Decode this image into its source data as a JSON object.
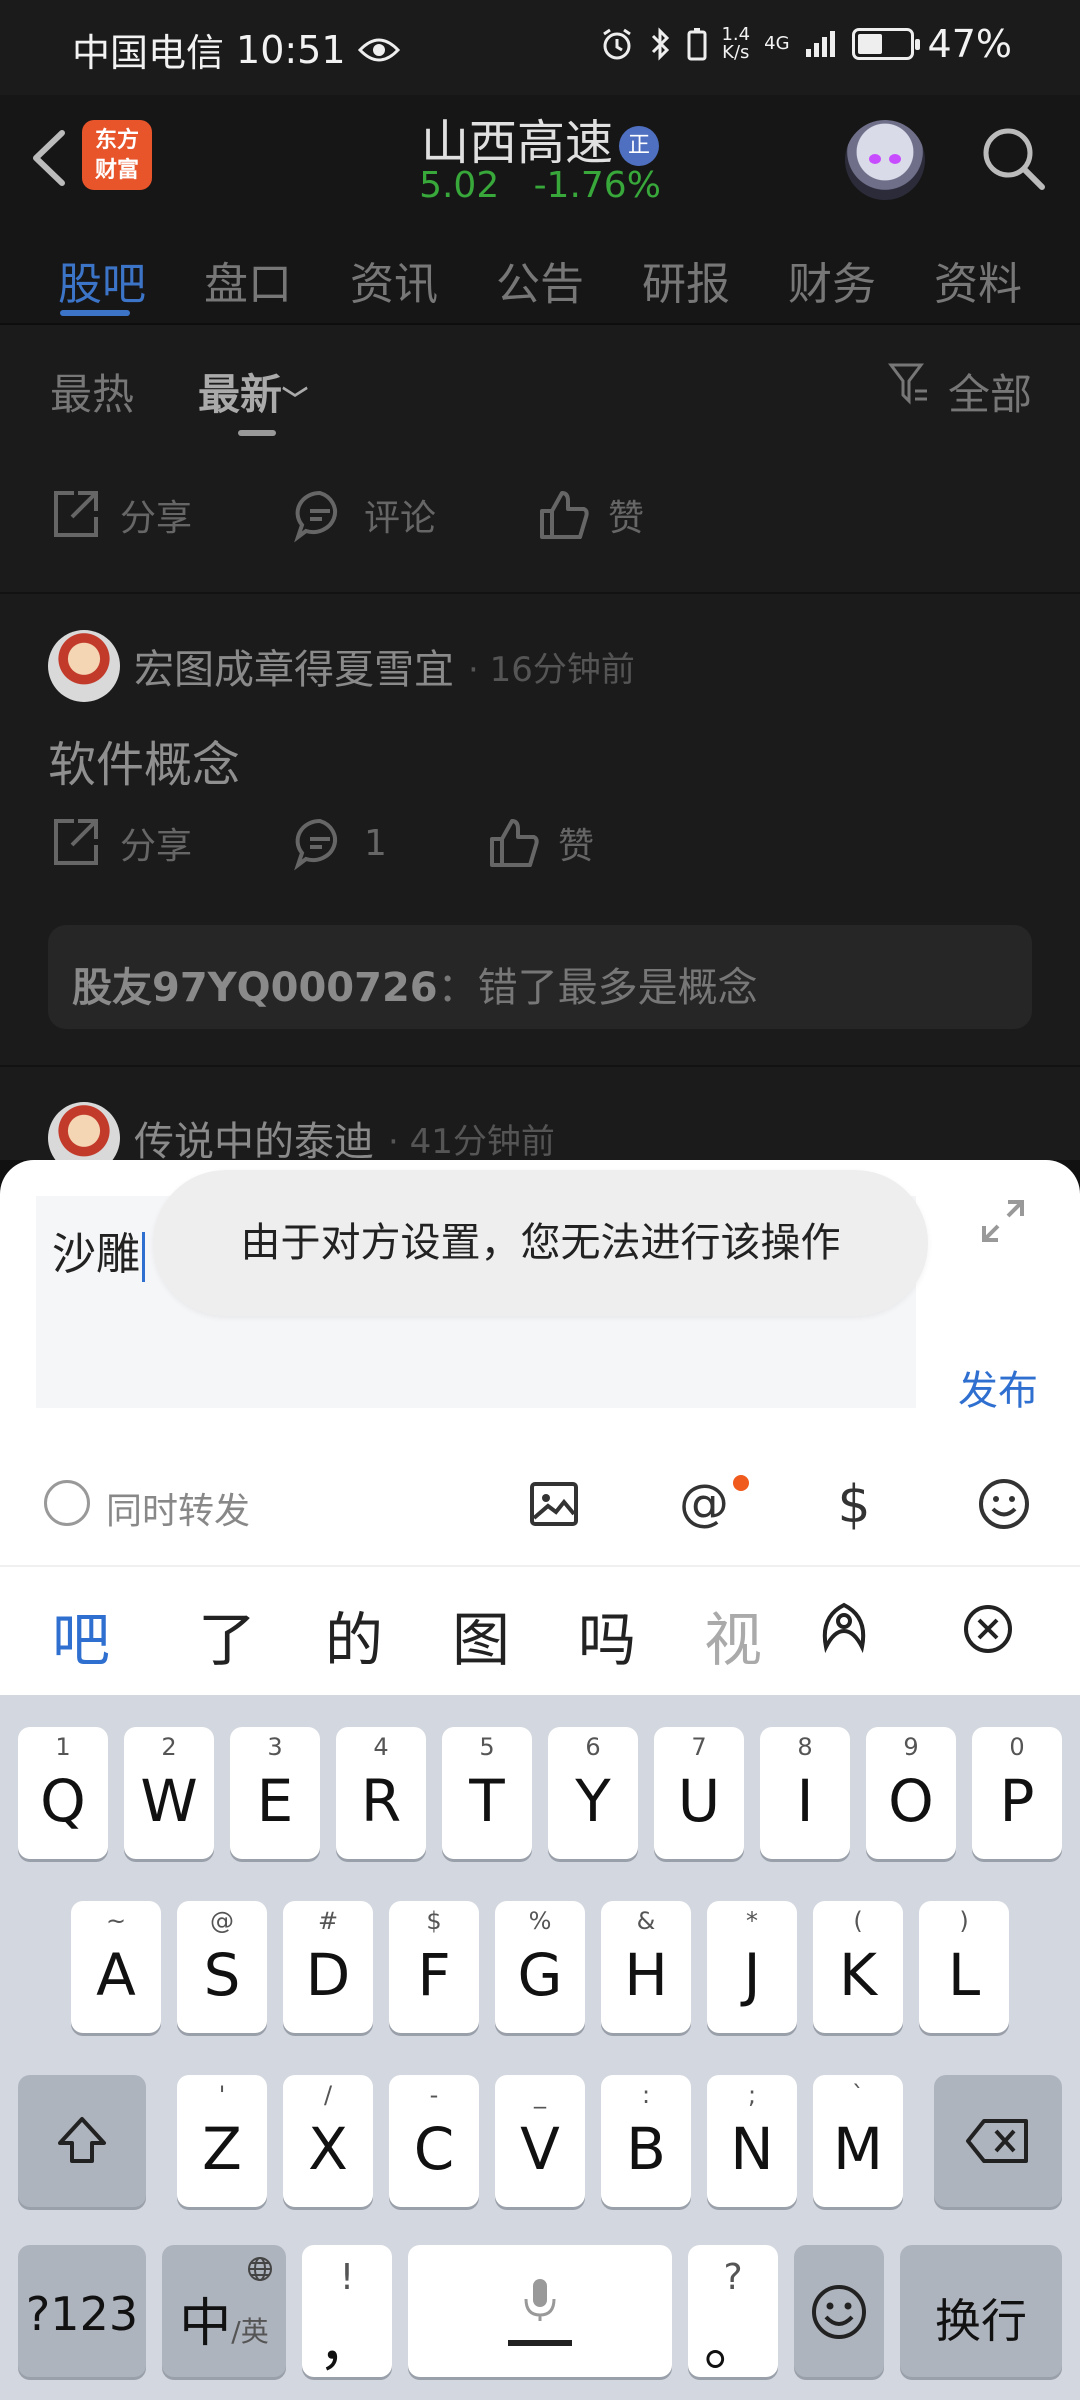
{
  "status_bar": {
    "carrier": "中国电信",
    "time": "10:51",
    "net_speed_value": "1.4",
    "net_speed_unit": "K/s",
    "signal_label": "4G",
    "battery_percent": "47%",
    "battery_level": 0.47
  },
  "header": {
    "app_logo_line1": "东方",
    "app_logo_line2": "财富",
    "stock_name": "山西高速",
    "stock_badge": "正",
    "price": "5.02",
    "change": "-1.76%",
    "colors": {
      "down": "#38a83b",
      "accent": "#3c74c8"
    }
  },
  "tabs": [
    "股吧",
    "盘口",
    "资讯",
    "公告",
    "研报",
    "财务",
    "资料"
  ],
  "filter": {
    "hot": "最热",
    "latest": "最新",
    "all": "全部"
  },
  "first_actions": {
    "share": "分享",
    "comment": "评论",
    "like": "赞"
  },
  "posts": [
    {
      "user": "宏图成章得夏雪宜",
      "time": "· 16分钟前",
      "text": "软件概念",
      "share": "分享",
      "comments": "1",
      "like": "赞",
      "reply_user": "股友97YQ000726",
      "reply_text": "：错了最多是概念"
    },
    {
      "user": "传说中的泰迪",
      "time": "· 41分钟前"
    }
  ],
  "composer": {
    "input_value": "沙雕",
    "toast": "由于对方设置，您无法进行该操作",
    "publish": "发布",
    "forward_label": "同时转发",
    "icons": [
      "image-icon",
      "at-icon",
      "dollar-icon",
      "emoji-icon"
    ]
  },
  "candidates": [
    "吧",
    "了",
    "的",
    "图",
    "吗",
    "视"
  ],
  "keyboard": {
    "row1": [
      {
        "main": "Q",
        "sup": "1"
      },
      {
        "main": "W",
        "sup": "2"
      },
      {
        "main": "E",
        "sup": "3"
      },
      {
        "main": "R",
        "sup": "4"
      },
      {
        "main": "T",
        "sup": "5"
      },
      {
        "main": "Y",
        "sup": "6"
      },
      {
        "main": "U",
        "sup": "7"
      },
      {
        "main": "I",
        "sup": "8"
      },
      {
        "main": "O",
        "sup": "9"
      },
      {
        "main": "P",
        "sup": "0"
      }
    ],
    "row2": [
      {
        "main": "A",
        "sup": "~"
      },
      {
        "main": "S",
        "sup": "@"
      },
      {
        "main": "D",
        "sup": "#"
      },
      {
        "main": "F",
        "sup": "$"
      },
      {
        "main": "G",
        "sup": "%"
      },
      {
        "main": "H",
        "sup": "&"
      },
      {
        "main": "J",
        "sup": "*"
      },
      {
        "main": "K",
        "sup": "("
      },
      {
        "main": "L",
        "sup": ")"
      }
    ],
    "row3": [
      {
        "main": "Z",
        "sup": "'"
      },
      {
        "main": "X",
        "sup": "/"
      },
      {
        "main": "C",
        "sup": "-"
      },
      {
        "main": "V",
        "sup": "_"
      },
      {
        "main": "B",
        "sup": ":"
      },
      {
        "main": "N",
        "sup": ";"
      },
      {
        "main": "M",
        "sup": "`"
      }
    ],
    "numbers_key": "?123",
    "lang_key_main": "中",
    "lang_key_sub": "/英",
    "comma_main": "，",
    "comma_sup": "!",
    "period_main": "。",
    "period_sup": "?",
    "enter_key": "换行"
  }
}
